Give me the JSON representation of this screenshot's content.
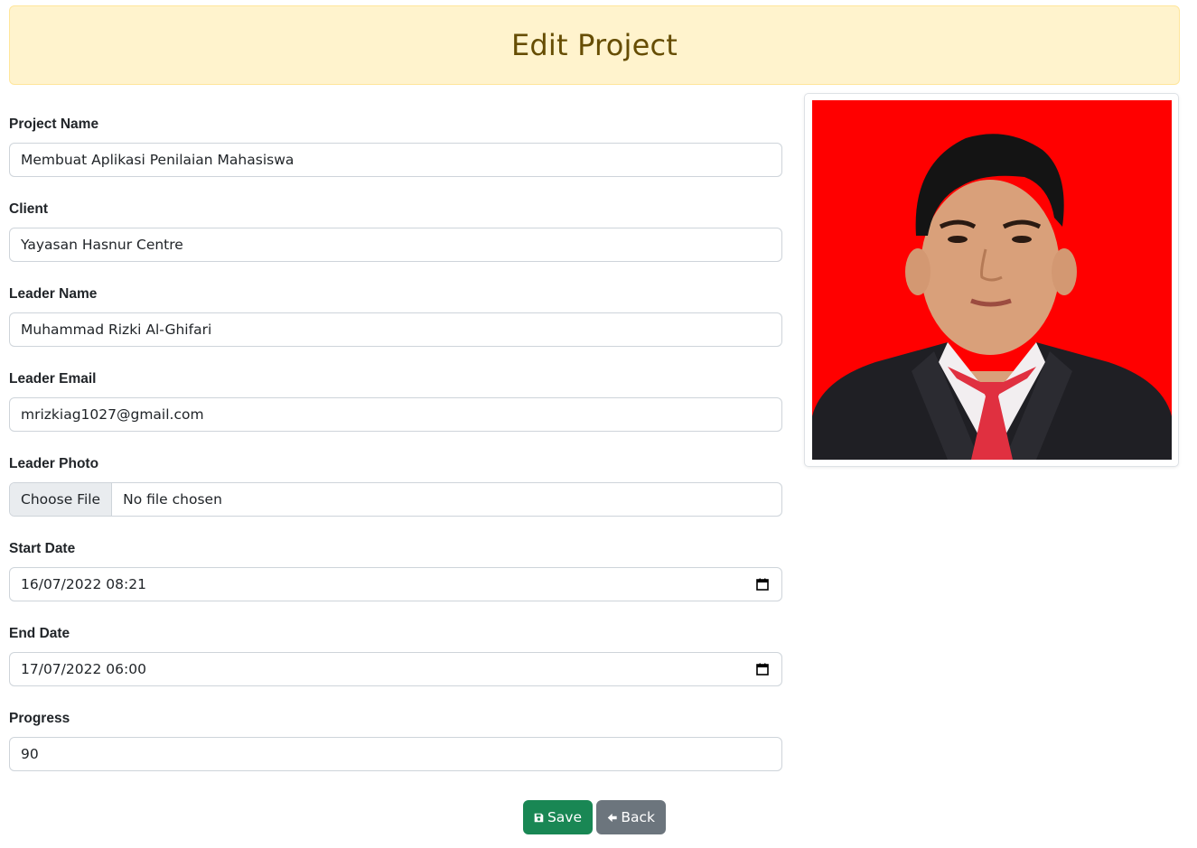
{
  "header": {
    "title": "Edit Project"
  },
  "form": {
    "fields": [
      {
        "label": "Project Name",
        "value": "Membuat Aplikasi Penilaian Mahasiswa"
      },
      {
        "label": "Client",
        "value": "Yayasan Hasnur Centre"
      },
      {
        "label": "Leader Name",
        "value": "Muhammad Rizki Al-Ghifari"
      },
      {
        "label": "Leader Email",
        "value": "mrizkiag1027@gmail.com"
      },
      {
        "label": "Leader Photo",
        "button": "Choose File",
        "value": "No file chosen"
      },
      {
        "label": "Start Date",
        "value": "16/07/2022 08:21"
      },
      {
        "label": "End Date",
        "value": "17/07/2022 06:00"
      },
      {
        "label": "Progress",
        "value": "90"
      }
    ]
  },
  "photo": {
    "background_color": "#ff0000",
    "icon": "leader-photo"
  },
  "actions": {
    "save_label": "Save",
    "back_label": "Back",
    "save_icon": "floppy-disk-icon",
    "back_icon": "arrow-left-icon"
  },
  "colors": {
    "header_bg": "#fff3cd",
    "header_text": "#664d03",
    "save_bg": "#198754",
    "back_bg": "#6c757d"
  }
}
